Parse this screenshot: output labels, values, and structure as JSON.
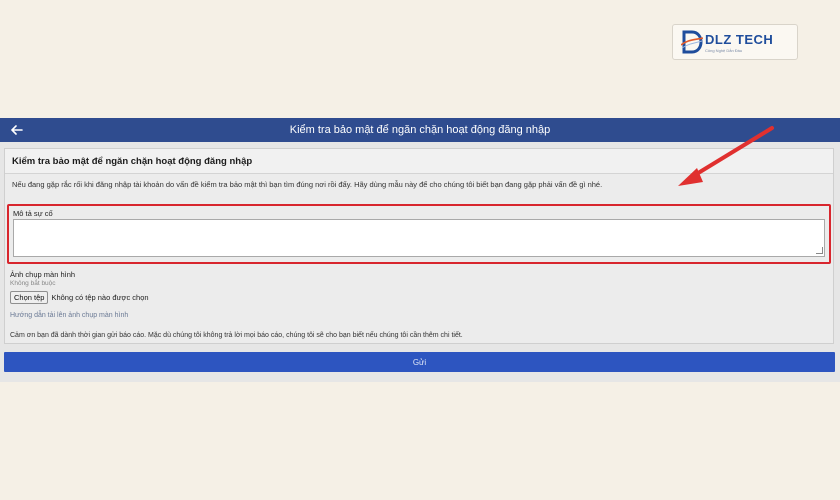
{
  "logo": {
    "name": "DLZ TECH",
    "tagline": "Công Nghệ Dẫn Đầu"
  },
  "header": {
    "title": "Kiểm tra bảo mật để ngăn chặn hoạt động đăng nhập",
    "back_icon": "arrow-left-icon"
  },
  "form": {
    "heading": "Kiểm tra bảo mật để ngăn chặn hoạt động đăng nhập",
    "intro": "Nếu đang gặp rắc rối khi đăng nhập tài khoản do vấn đề kiểm tra bảo mật thì bạn tìm đúng nơi rồi đấy. Hãy dùng mẫu này để cho chúng tôi biết bạn đang gặp phải vấn đề gì nhé.",
    "description_label": "Mô tả sự cố",
    "description_value": "",
    "screenshot_label": "Ảnh chụp màn hình",
    "screenshot_hint": "Không bắt buộc",
    "file_button": "Chọn tệp",
    "file_status": "Không có tệp nào được chọn",
    "upload_help": "Hướng dẫn tải lên ảnh chụp màn hình",
    "thanks": "Cảm ơn bạn đã dành thời gian gửi báo cáo. Mặc dù chúng tôi không trả lời mọi báo cáo, chúng tôi sẽ cho bạn biết nếu chúng tôi cần thêm chi tiết.",
    "submit": "Gửi"
  },
  "colors": {
    "header_bg": "#2f4c8f",
    "highlight": "#d8262e",
    "submit_bg": "#2d55c0",
    "page_bg": "#f5f0e6"
  }
}
